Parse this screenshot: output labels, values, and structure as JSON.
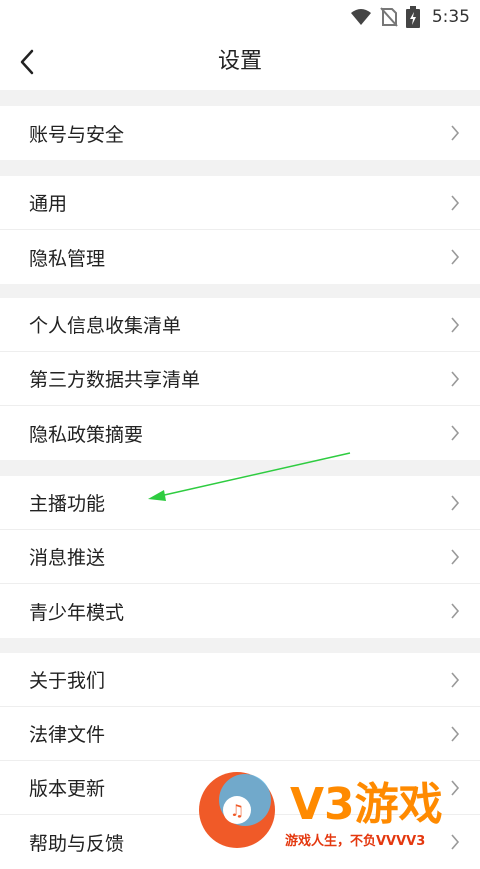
{
  "status": {
    "time": "5:35"
  },
  "header": {
    "title": "设置"
  },
  "sections": [
    {
      "items": [
        {
          "label": "账号与安全"
        }
      ]
    },
    {
      "items": [
        {
          "label": "通用"
        },
        {
          "label": "隐私管理"
        }
      ]
    },
    {
      "items": [
        {
          "label": "个人信息收集清单"
        },
        {
          "label": "第三方数据共享清单"
        },
        {
          "label": "隐私政策摘要"
        }
      ]
    },
    {
      "items": [
        {
          "label": "主播功能"
        },
        {
          "label": "消息推送"
        },
        {
          "label": "青少年模式"
        }
      ]
    },
    {
      "items": [
        {
          "label": "关于我们"
        },
        {
          "label": "法律文件"
        },
        {
          "label": "版本更新"
        },
        {
          "label": "帮助与反馈"
        }
      ]
    }
  ],
  "watermark": {
    "brand": "V3游戏",
    "slogan": "游戏人生，不负VVVV3"
  }
}
